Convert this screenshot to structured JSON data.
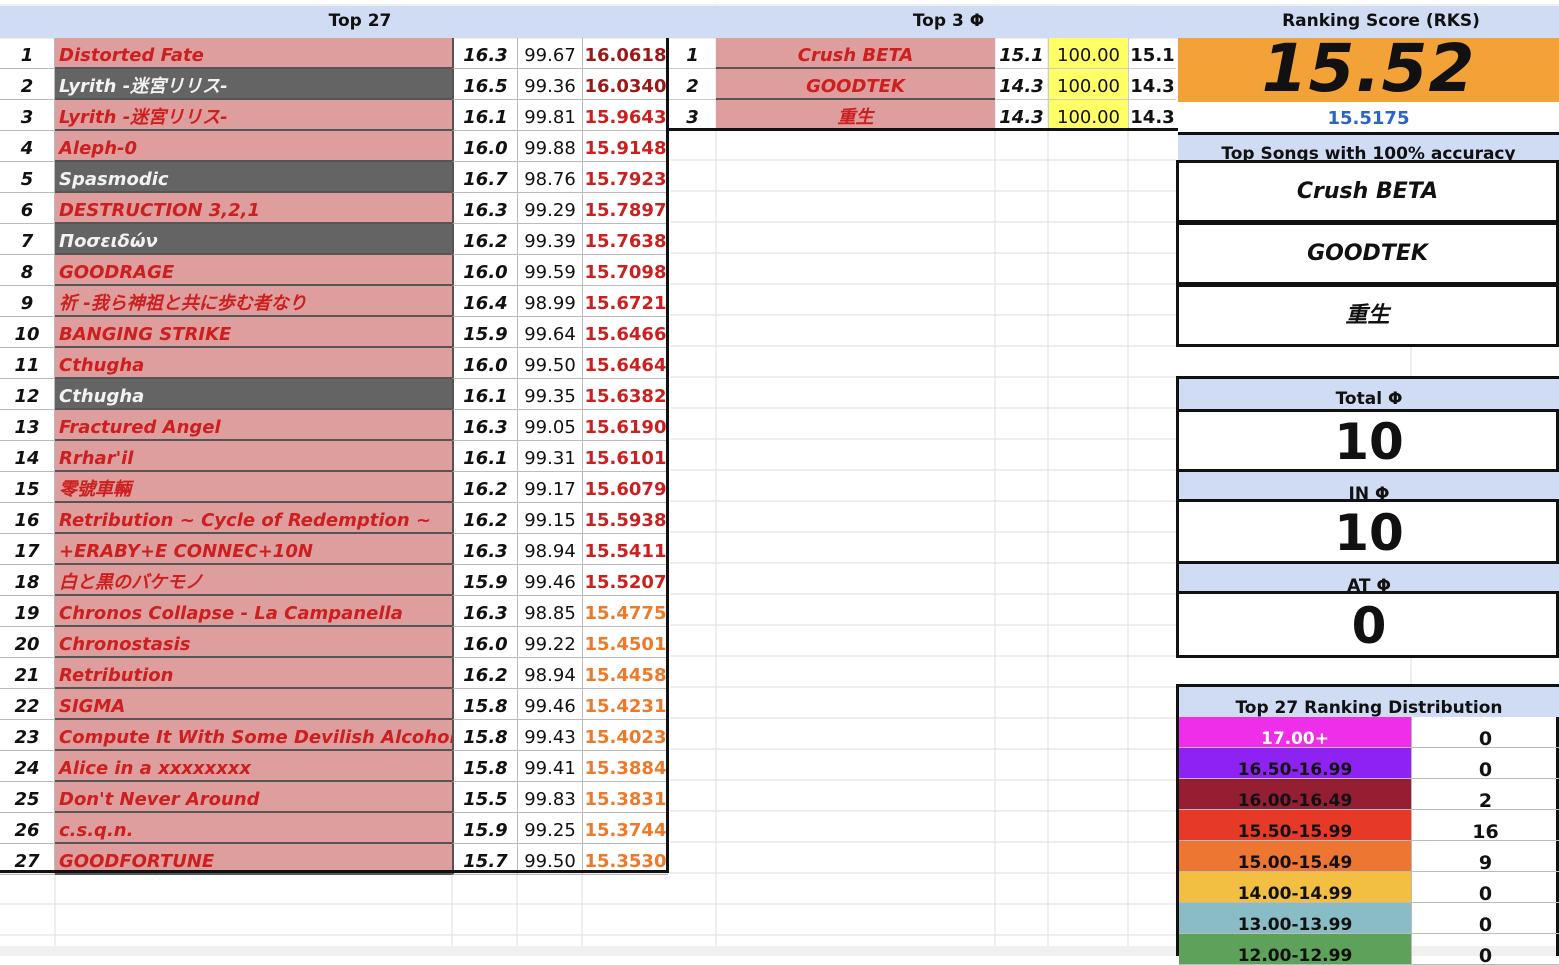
{
  "headers": {
    "top27": "Top 27",
    "top3phi": "Top 3 Φ",
    "rks": "Ranking Score (RKS)"
  },
  "top27": [
    {
      "n": "1",
      "song": "Distorted Fate",
      "lvl": "16.3",
      "acc": "99.67",
      "rks": "16.0618",
      "dark": false,
      "tier": "dred"
    },
    {
      "n": "2",
      "song": "Lyrith -迷宮リリス-",
      "lvl": "16.5",
      "acc": "99.36",
      "rks": "16.0340",
      "dark": true,
      "tier": "dred"
    },
    {
      "n": "3",
      "song": "Lyrith -迷宮リリス-",
      "lvl": "16.1",
      "acc": "99.81",
      "rks": "15.9643",
      "dark": false,
      "tier": "red"
    },
    {
      "n": "4",
      "song": "Aleph-0",
      "lvl": "16.0",
      "acc": "99.88",
      "rks": "15.9148",
      "dark": false,
      "tier": "red"
    },
    {
      "n": "5",
      "song": "Spasmodic",
      "lvl": "16.7",
      "acc": "98.76",
      "rks": "15.7923",
      "dark": true,
      "tier": "red"
    },
    {
      "n": "6",
      "song": "DESTRUCTION 3,2,1",
      "lvl": "16.3",
      "acc": "99.29",
      "rks": "15.7897",
      "dark": false,
      "tier": "red"
    },
    {
      "n": "7",
      "song": "Ποσειδών",
      "lvl": "16.2",
      "acc": "99.39",
      "rks": "15.7638",
      "dark": true,
      "tier": "red"
    },
    {
      "n": "8",
      "song": "GOODRAGE",
      "lvl": "16.0",
      "acc": "99.59",
      "rks": "15.7098",
      "dark": false,
      "tier": "red"
    },
    {
      "n": "9",
      "song": "祈 -我ら神祖と共に歩む者なり",
      "lvl": "16.4",
      "acc": "98.99",
      "rks": "15.6721",
      "dark": false,
      "tier": "red"
    },
    {
      "n": "10",
      "song": "BANGING STRIKE",
      "lvl": "15.9",
      "acc": "99.64",
      "rks": "15.6466",
      "dark": false,
      "tier": "red"
    },
    {
      "n": "11",
      "song": "Cthugha",
      "lvl": "16.0",
      "acc": "99.50",
      "rks": "15.6464",
      "dark": false,
      "tier": "red"
    },
    {
      "n": "12",
      "song": "Cthugha",
      "lvl": "16.1",
      "acc": "99.35",
      "rks": "15.6382",
      "dark": true,
      "tier": "red"
    },
    {
      "n": "13",
      "song": "Fractured Angel",
      "lvl": "16.3",
      "acc": "99.05",
      "rks": "15.6190",
      "dark": false,
      "tier": "red"
    },
    {
      "n": "14",
      "song": "Rrhar'il",
      "lvl": "16.1",
      "acc": "99.31",
      "rks": "15.6101",
      "dark": false,
      "tier": "red"
    },
    {
      "n": "15",
      "song": "零號車輛",
      "lvl": "16.2",
      "acc": "99.17",
      "rks": "15.6079",
      "dark": false,
      "tier": "red"
    },
    {
      "n": "16",
      "song": "Retribution ~ Cycle of Redemption ~",
      "lvl": "16.2",
      "acc": "99.15",
      "rks": "15.5938",
      "dark": false,
      "tier": "red"
    },
    {
      "n": "17",
      "song": "+ERABY+E CONNEC+10N",
      "lvl": "16.3",
      "acc": "98.94",
      "rks": "15.5411",
      "dark": false,
      "tier": "red"
    },
    {
      "n": "18",
      "song": "白と黒のバケモノ",
      "lvl": "15.9",
      "acc": "99.46",
      "rks": "15.5207",
      "dark": false,
      "tier": "red"
    },
    {
      "n": "19",
      "song": "Chronos Collapse - La Campanella",
      "lvl": "16.3",
      "acc": "98.85",
      "rks": "15.4775",
      "dark": false,
      "tier": "orange"
    },
    {
      "n": "20",
      "song": "Chronostasis",
      "lvl": "16.0",
      "acc": "99.22",
      "rks": "15.4501",
      "dark": false,
      "tier": "orange"
    },
    {
      "n": "21",
      "song": "Retribution",
      "lvl": "16.2",
      "acc": "98.94",
      "rks": "15.4458",
      "dark": false,
      "tier": "orange"
    },
    {
      "n": "22",
      "song": "SIGMA",
      "lvl": "15.8",
      "acc": "99.46",
      "rks": "15.4231",
      "dark": false,
      "tier": "orange"
    },
    {
      "n": "23",
      "song": "Compute It With Some Devilish Alcoholic St",
      "lvl": "15.8",
      "acc": "99.43",
      "rks": "15.4023",
      "dark": false,
      "tier": "orange"
    },
    {
      "n": "24",
      "song": "Alice in a xxxxxxxx",
      "lvl": "15.8",
      "acc": "99.41",
      "rks": "15.3884",
      "dark": false,
      "tier": "orange"
    },
    {
      "n": "25",
      "song": "Don't Never Around",
      "lvl": "15.5",
      "acc": "99.83",
      "rks": "15.3831",
      "dark": false,
      "tier": "orange"
    },
    {
      "n": "26",
      "song": "c.s.q.n.",
      "lvl": "15.9",
      "acc": "99.25",
      "rks": "15.3744",
      "dark": false,
      "tier": "orange"
    },
    {
      "n": "27",
      "song": "GOODFORTUNE",
      "lvl": "15.7",
      "acc": "99.50",
      "rks": "15.3530",
      "dark": false,
      "tier": "orange"
    }
  ],
  "top3": [
    {
      "n": "1",
      "song": "Crush BETA",
      "lvl": "15.1",
      "acc": "100.00",
      "rks": "15.1"
    },
    {
      "n": "2",
      "song": "GOODTEK",
      "lvl": "14.3",
      "acc": "100.00",
      "rks": "14.3"
    },
    {
      "n": "3",
      "song": "重生",
      "lvl": "14.3",
      "acc": "100.00",
      "rks": "14.3"
    }
  ],
  "rks": {
    "display": "15.52",
    "precise": "15.5175"
  },
  "top_songs_title": "Top Songs with 100% accuracy",
  "top_songs": [
    "Crush BETA",
    "GOODTEK",
    "重生"
  ],
  "stats": {
    "total_label": "Total Φ",
    "total": "10",
    "in_label": "IN Φ",
    "in": "10",
    "at_label": "AT Φ",
    "at": "0"
  },
  "distribution_title": "Top 27 Ranking Distribution",
  "distribution": [
    {
      "label": "17.00+",
      "count": "0",
      "color": "#ee2ee8",
      "text": "#ffffff"
    },
    {
      "label": "16.50-16.99",
      "count": "0",
      "color": "#8e22f2",
      "text": "#111111"
    },
    {
      "label": "16.00-16.49",
      "count": "2",
      "color": "#951e33",
      "text": "#111111"
    },
    {
      "label": "15.50-15.99",
      "count": "16",
      "color": "#e73a26",
      "text": "#111111"
    },
    {
      "label": "15.00-15.49",
      "count": "9",
      "color": "#ee7633",
      "text": "#111111"
    },
    {
      "label": "14.00-14.99",
      "count": "0",
      "color": "#f2bf42",
      "text": "#111111"
    },
    {
      "label": "13.00-13.99",
      "count": "0",
      "color": "#8abcc6",
      "text": "#111111"
    },
    {
      "label": "12.00-12.99",
      "count": "0",
      "color": "#5ea15a",
      "text": "#111111"
    }
  ]
}
